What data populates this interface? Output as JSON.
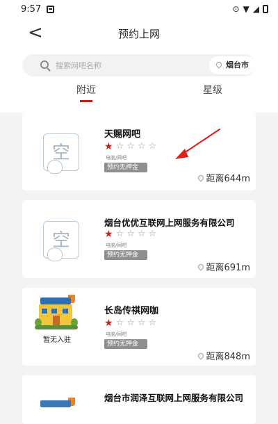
{
  "status_bar": {
    "time": "9:57"
  },
  "nav": {
    "back_glyph": "<",
    "title": "预约上网"
  },
  "search": {
    "placeholder": "搜索网吧名称",
    "city": "烟台市"
  },
  "tabs": [
    {
      "label": "附近",
      "active": true
    },
    {
      "label": "星级",
      "active": false
    }
  ],
  "colors": {
    "accent": "#c02020",
    "star_active": "#d41b1b",
    "tag_bg": "#8f8f8f",
    "annotation_arrow": "#e0201b"
  },
  "listings": [
    {
      "name": "天赐网吧",
      "rating": 1,
      "max_rating": 5,
      "category": "电脑/网吧",
      "tag": "预约无押金",
      "distance": "距离644m",
      "thumb": "placeholder"
    },
    {
      "name": "烟台优优互联网上网服务有限公司",
      "rating": 1,
      "max_rating": 5,
      "category": "电脑/网吧",
      "tag": "预约无押金",
      "distance": "距离691m",
      "thumb": "placeholder"
    },
    {
      "name": "长岛传祺网咖",
      "rating": 1,
      "max_rating": 5,
      "category": "电脑/网吧",
      "tag": "预约无押金",
      "distance": "距离848m",
      "thumb": "building",
      "thumb_label": "暂无入驻"
    },
    {
      "name": "烟台市润泽互联网上网服务有限公司",
      "thumb": "building"
    }
  ]
}
